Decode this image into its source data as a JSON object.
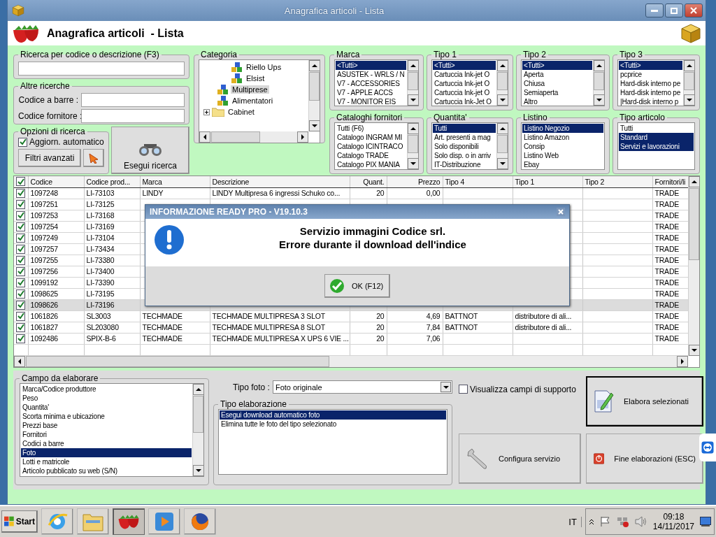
{
  "window": {
    "title": "Anagrafica articoli - Lista"
  },
  "header": {
    "title": "Anagrafica articoli  - Lista"
  },
  "search": {
    "title": "Ricerca per codice o descrizione (F3)"
  },
  "other_searches": {
    "title": "Altre ricerche",
    "fields": [
      {
        "label": "Codice a barre :"
      },
      {
        "label": "Codice fornitore :"
      }
    ]
  },
  "search_options": {
    "title": "Opzioni di ricerca",
    "auto_update": {
      "label": "Aggiorn. automatico",
      "checked": true
    },
    "advanced_button": "Filtri avanzati"
  },
  "search_button": "Esegui ricerca",
  "category": {
    "title": "Categoria",
    "tree": [
      {
        "children": [
          {
            "children": [
              {
                "label": "Riello Ups",
                "kind": "category",
                "selected": false
              },
              {
                "label": "Elsist",
                "kind": "category",
                "selected": false
              }
            ]
          },
          {
            "label": "Multiprese",
            "kind": "category",
            "selected": true
          },
          {
            "label": "Alimentatori",
            "kind": "category",
            "selected": false
          }
        ]
      },
      {
        "label": "Cabinet",
        "kind": "folder",
        "selected": false,
        "expanded": false
      }
    ]
  },
  "filter_lists": [
    {
      "title": "Marca",
      "scrollbar": true,
      "items": [
        {
          "label": "<Tutti>",
          "selected": true
        },
        {
          "label": "ASUSTEK - WRLS / N",
          "selected": false
        },
        {
          "label": "V7 - ACCESSORIES",
          "selected": false
        },
        {
          "label": "V7 - APPLE ACCS",
          "selected": false
        },
        {
          "label": "V7 - MONITOR EIS",
          "selected": false
        }
      ]
    },
    {
      "title": "Tipo 1",
      "scrollbar": true,
      "items": [
        {
          "label": "<Tutti>",
          "selected": true
        },
        {
          "label": "Cartuccia Ink-jet O",
          "selected": false
        },
        {
          "label": "Cartuccia Ink-jet O",
          "selected": false
        },
        {
          "label": "Cartuccia Ink-jet O",
          "selected": false
        },
        {
          "label": "Cartuccia Ink-Jet O",
          "selected": false
        }
      ]
    },
    {
      "title": "Tipo 2",
      "scrollbar": true,
      "items": [
        {
          "label": "<Tutti>",
          "selected": true
        },
        {
          "label": "Aperta",
          "selected": false
        },
        {
          "label": "Chiusa",
          "selected": false
        },
        {
          "label": "Semiaperta",
          "selected": false
        },
        {
          "label": "Altro",
          "selected": false
        }
      ]
    },
    {
      "title": "Tipo 3",
      "scrollbar": true,
      "items": [
        {
          "label": "<Tutti>",
          "selected": true
        },
        {
          "label": "pcprice",
          "selected": false
        },
        {
          "label": "Hard-disk interno pe",
          "selected": false
        },
        {
          "label": "Hard-disk interno pe",
          "selected": false
        },
        {
          "label": "|Hard-disk interno p",
          "selected": false
        }
      ]
    },
    {
      "title": "Cataloghi fornitori",
      "scrollbar": true,
      "items": [
        {
          "label": "Tutti (F6)",
          "selected": false
        },
        {
          "label": "Catalogo INGRAM MI",
          "selected": false
        },
        {
          "label": "Catalogo ICINTRACO",
          "selected": false
        },
        {
          "label": "Catalogo TRADE",
          "selected": false
        },
        {
          "label": "Catalogo PIX MANIA",
          "selected": false
        }
      ]
    },
    {
      "title": "Quantita'",
      "scrollbar": true,
      "items": [
        {
          "label": "Tutti",
          "selected": true
        },
        {
          "label": "Art. presenti a mag",
          "selected": false
        },
        {
          "label": "Solo disponibili",
          "selected": false
        },
        {
          "label": "Solo disp. o in arriv",
          "selected": false
        },
        {
          "label": "IT-Distribuzione",
          "selected": false
        }
      ]
    },
    {
      "title": "Listino",
      "scrollbar": false,
      "items": [
        {
          "label": "Listino Negozio",
          "selected": true
        },
        {
          "label": "Listino Amazon",
          "selected": false
        },
        {
          "label": "Consip",
          "selected": false
        },
        {
          "label": "Listino Web",
          "selected": false
        },
        {
          "label": "Ebay",
          "selected": false
        }
      ]
    },
    {
      "title": "Tipo articolo",
      "scrollbar": false,
      "items": [
        {
          "label": "Tutti",
          "selected": false
        },
        {
          "label": "Standard",
          "selected": true
        },
        {
          "label": "Servizi e lavorazioni",
          "selected": true
        }
      ]
    }
  ],
  "table": {
    "header_checked": true,
    "columns": [
      {
        "label": "Codice",
        "kind": "text"
      },
      {
        "label": "Codice prod...",
        "kind": "text"
      },
      {
        "label": "Marca",
        "kind": "text"
      },
      {
        "label": "Descrizione",
        "kind": "text"
      },
      {
        "label": "Quant.",
        "kind": "number"
      },
      {
        "label": "Prezzo",
        "kind": "number"
      },
      {
        "label": "Tipo 4",
        "kind": "text"
      },
      {
        "label": "Tipo 1",
        "kind": "text"
      },
      {
        "label": "Tipo 2",
        "kind": "text"
      },
      {
        "label": "Fornitori/li",
        "kind": "text"
      }
    ],
    "rows": [
      {
        "checked": true,
        "selected": false,
        "cells": [
          "1097248",
          "LI-73103",
          "LINDY",
          "LINDY Multipresa 6 ingressi Schuko co...",
          "20",
          "0,00",
          null,
          null,
          null,
          "TRADE"
        ]
      },
      {
        "checked": true,
        "selected": false,
        "cells": [
          "1097251",
          "LI-73125",
          null,
          null,
          null,
          null,
          null,
          null,
          null,
          "TRADE"
        ]
      },
      {
        "checked": true,
        "selected": false,
        "cells": [
          "1097253",
          "LI-73168",
          null,
          null,
          null,
          null,
          null,
          null,
          null,
          "TRADE"
        ]
      },
      {
        "checked": true,
        "selected": false,
        "cells": [
          "1097254",
          "LI-73169",
          null,
          null,
          null,
          null,
          null,
          null,
          null,
          "TRADE"
        ]
      },
      {
        "checked": true,
        "selected": false,
        "cells": [
          "1097249",
          "LI-73104",
          null,
          null,
          null,
          null,
          null,
          null,
          null,
          "TRADE"
        ]
      },
      {
        "checked": true,
        "selected": false,
        "cells": [
          "1097257",
          "LI-73434",
          null,
          null,
          null,
          null,
          null,
          null,
          null,
          "TRADE"
        ]
      },
      {
        "checked": true,
        "selected": false,
        "cells": [
          "1097255",
          "LI-73380",
          null,
          null,
          null,
          null,
          null,
          null,
          null,
          "TRADE"
        ]
      },
      {
        "checked": true,
        "selected": false,
        "cells": [
          "1097256",
          "LI-73400",
          null,
          null,
          null,
          null,
          null,
          null,
          null,
          "TRADE"
        ]
      },
      {
        "checked": true,
        "selected": false,
        "cells": [
          "1099192",
          "LI-73390",
          null,
          null,
          null,
          null,
          null,
          null,
          null,
          "TRADE"
        ]
      },
      {
        "checked": true,
        "selected": false,
        "cells": [
          "1098625",
          "LI-73195",
          null,
          null,
          null,
          null,
          null,
          null,
          null,
          "TRADE"
        ]
      },
      {
        "checked": true,
        "selected": true,
        "cells": [
          "1098626",
          "LI-73196",
          null,
          null,
          null,
          null,
          null,
          null,
          null,
          "TRADE"
        ]
      },
      {
        "checked": true,
        "selected": false,
        "cells": [
          "1061826",
          "SL3003",
          "TECHMADE",
          "TECHMADE MULTIPRESA 3 SLOT",
          "20",
          "4,69",
          "BATTNOT",
          "distributore di ali...",
          null,
          "TRADE"
        ]
      },
      {
        "checked": true,
        "selected": false,
        "cells": [
          "1061827",
          "SL203080",
          "TECHMADE",
          "TECHMADE MULTIPRESA 8 SLOT",
          "20",
          "7,84",
          "BATTNOT",
          "distributore di ali...",
          null,
          "TRADE"
        ]
      },
      {
        "checked": true,
        "selected": false,
        "cells": [
          "1092486",
          "SPIX-B-6",
          "TECHMADE",
          "TECHMADE MULTIPRESA X UPS 6 VIE ...",
          "20",
          "7,06",
          null,
          null,
          null,
          "TRADE"
        ]
      }
    ]
  },
  "dialog": {
    "title": "INFORMAZIONE READY PRO - V19.10.3",
    "lines": [
      "Servizio immagini Codice srl.",
      "Errore durante il download dell'indice"
    ],
    "button": "OK (F12)"
  },
  "process_field": {
    "title": "Campo da elaborare",
    "items": [
      {
        "label": "Marca/Codice produttore",
        "selected": false
      },
      {
        "label": "Peso",
        "selected": false
      },
      {
        "label": "Quantita'",
        "selected": false
      },
      {
        "label": "Scorta minima e ubicazione",
        "selected": false
      },
      {
        "label": "Prezzi base",
        "selected": false
      },
      {
        "label": "Fornitori",
        "selected": false
      },
      {
        "label": "Codici a barre",
        "selected": false
      },
      {
        "label": "Foto",
        "selected": true
      },
      {
        "label": "Lotti e matricole",
        "selected": false
      },
      {
        "label": "Articolo pubblicato su web (S/N)",
        "selected": false
      }
    ]
  },
  "photo_type": {
    "label": "Tipo foto :",
    "value": "Foto originale"
  },
  "process_type": {
    "title": "Tipo elaborazione",
    "items": [
      {
        "label": "Esegui download automatico foto",
        "selected": true
      },
      {
        "label": "Elimina tutte le foto del tipo selezionato",
        "selected": false
      }
    ]
  },
  "support_fields": {
    "label": "Visualizza campi di supporto",
    "checked": false
  },
  "actions": [
    {
      "label": "Elabora selezionati",
      "kind": "edit",
      "default": true
    },
    {
      "label": "Configura servizio",
      "kind": "wrench",
      "default": false
    },
    {
      "label": "Fine elaborazioni (ESC)",
      "kind": "power",
      "default": false
    }
  ],
  "taskbar": {
    "start": "Start",
    "apps": [
      {
        "kind": "browser",
        "active": false
      },
      {
        "kind": "explorer",
        "active": false
      },
      {
        "kind": "strawberry",
        "active": true
      },
      {
        "kind": "media",
        "active": false
      },
      {
        "kind": "firefox",
        "active": false
      }
    ],
    "language": "IT",
    "time": "09:18",
    "date": "14/11/2017"
  }
}
